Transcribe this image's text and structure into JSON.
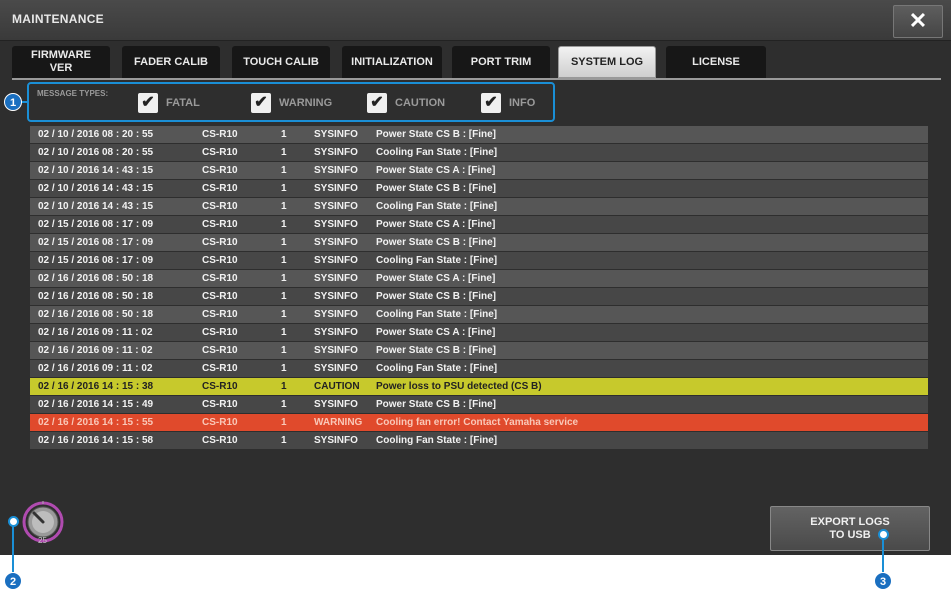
{
  "window": {
    "title": "MAINTENANCE",
    "close_label": "✕"
  },
  "tabs": [
    {
      "label": "FIRMWARE VER",
      "active": false
    },
    {
      "label": "FADER CALIB",
      "active": false
    },
    {
      "label": "TOUCH CALIB",
      "active": false
    },
    {
      "label": "INITIALIZATION",
      "active": false
    },
    {
      "label": "PORT TRIM",
      "active": false
    },
    {
      "label": "SYSTEM LOG",
      "active": true
    },
    {
      "label": "LICENSE",
      "active": false
    }
  ],
  "filters": {
    "label": "MESSAGE TYPES:",
    "items": [
      {
        "label": "FATAL",
        "checked": true
      },
      {
        "label": "WARNING",
        "checked": true
      },
      {
        "label": "CAUTION",
        "checked": true
      },
      {
        "label": "INFO",
        "checked": true
      }
    ]
  },
  "log": [
    {
      "date": "02 / 10 / 2016   08 : 20 : 55",
      "device": "CS-R10",
      "num": "1",
      "type": "SYSINFO",
      "message": "Power State CS B : [Fine]",
      "level": "info"
    },
    {
      "date": "02 / 10 / 2016   08 : 20 : 55",
      "device": "CS-R10",
      "num": "1",
      "type": "SYSINFO",
      "message": "Cooling Fan State : [Fine]",
      "level": "info"
    },
    {
      "date": "02 / 10 / 2016   14 : 43 : 15",
      "device": "CS-R10",
      "num": "1",
      "type": "SYSINFO",
      "message": "Power State CS A : [Fine]",
      "level": "info"
    },
    {
      "date": "02 / 10 / 2016   14 : 43 : 15",
      "device": "CS-R10",
      "num": "1",
      "type": "SYSINFO",
      "message": "Power State CS B : [Fine]",
      "level": "info"
    },
    {
      "date": "02 / 10 / 2016   14 : 43 : 15",
      "device": "CS-R10",
      "num": "1",
      "type": "SYSINFO",
      "message": "Cooling Fan State : [Fine]",
      "level": "info"
    },
    {
      "date": "02 / 15 / 2016   08 : 17 : 09",
      "device": "CS-R10",
      "num": "1",
      "type": "SYSINFO",
      "message": "Power State CS A : [Fine]",
      "level": "info"
    },
    {
      "date": "02 / 15 / 2016   08 : 17 : 09",
      "device": "CS-R10",
      "num": "1",
      "type": "SYSINFO",
      "message": "Power State CS B : [Fine]",
      "level": "info"
    },
    {
      "date": "02 / 15 / 2016   08 : 17 : 09",
      "device": "CS-R10",
      "num": "1",
      "type": "SYSINFO",
      "message": "Cooling Fan State : [Fine]",
      "level": "info"
    },
    {
      "date": "02 / 16 / 2016   08 : 50 : 18",
      "device": "CS-R10",
      "num": "1",
      "type": "SYSINFO",
      "message": "Power State CS A : [Fine]",
      "level": "info"
    },
    {
      "date": "02 / 16 / 2016   08 : 50 : 18",
      "device": "CS-R10",
      "num": "1",
      "type": "SYSINFO",
      "message": "Power State CS B : [Fine]",
      "level": "info"
    },
    {
      "date": "02 / 16 / 2016   08 : 50 : 18",
      "device": "CS-R10",
      "num": "1",
      "type": "SYSINFO",
      "message": "Cooling Fan State : [Fine]",
      "level": "info"
    },
    {
      "date": "02 / 16 / 2016   09 : 11 : 02",
      "device": "CS-R10",
      "num": "1",
      "type": "SYSINFO",
      "message": "Power State CS A : [Fine]",
      "level": "info"
    },
    {
      "date": "02 / 16 / 2016   09 : 11 : 02",
      "device": "CS-R10",
      "num": "1",
      "type": "SYSINFO",
      "message": "Power State CS B : [Fine]",
      "level": "info"
    },
    {
      "date": "02 / 16 / 2016   09 : 11 : 02",
      "device": "CS-R10",
      "num": "1",
      "type": "SYSINFO",
      "message": "Cooling Fan State : [Fine]",
      "level": "info"
    },
    {
      "date": "02 / 16 / 2016   14 : 15 : 38",
      "device": "CS-R10",
      "num": "1",
      "type": "CAUTION",
      "message": "Power loss to PSU detected (CS B)",
      "level": "caution"
    },
    {
      "date": "02 / 16 / 2016   14 : 15 : 49",
      "device": "CS-R10",
      "num": "1",
      "type": "SYSINFO",
      "message": "Power State CS B : [Fine]",
      "level": "info"
    },
    {
      "date": "02 / 16 / 2016   14 : 15 : 55",
      "device": "CS-R10",
      "num": "1",
      "type": "WARNING",
      "message": "Cooling fan error! Contact Yamaha service",
      "level": "warning"
    },
    {
      "date": "02 / 16 / 2016   14 : 15 : 58",
      "device": "CS-R10",
      "num": "1",
      "type": "SYSINFO",
      "message": "Cooling Fan State : [Fine]",
      "level": "info"
    }
  ],
  "scroll_knob": {
    "value": "25",
    "icon": "rotary-knob-icon"
  },
  "export_button": {
    "line1": "EXPORT LOGS",
    "line2": "TO USB"
  },
  "callouts": [
    "1",
    "2",
    "3"
  ],
  "colors": {
    "accent": "#1a8fd6",
    "caution": "#c7c92c",
    "warning": "#e04a2c",
    "knob_ring": "#b04bb0"
  }
}
